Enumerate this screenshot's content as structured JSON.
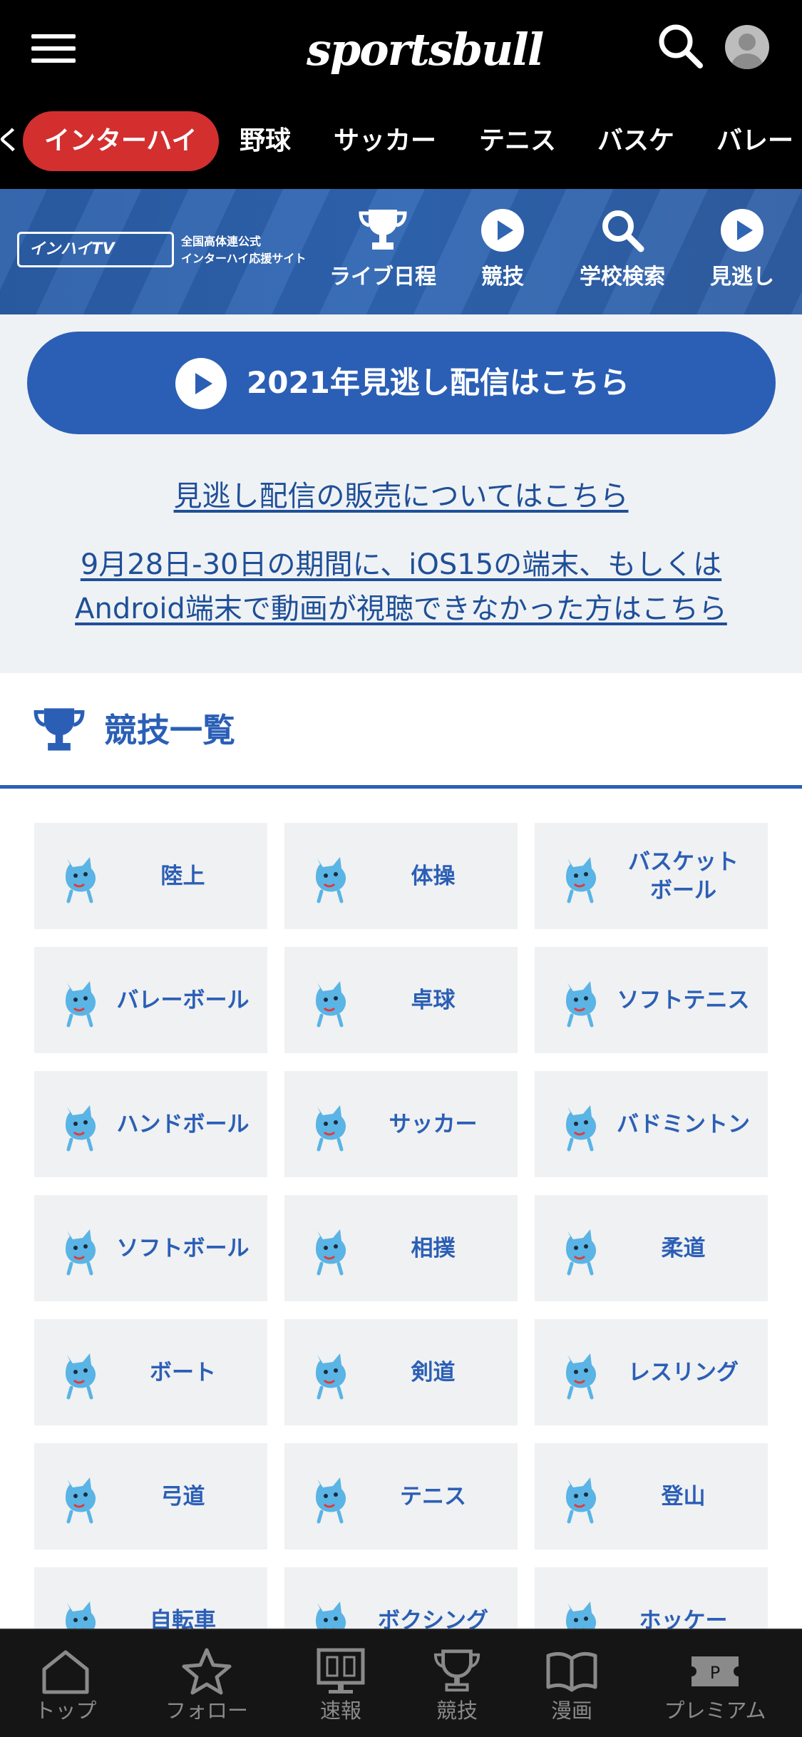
{
  "app": {
    "logo_text": "sportsbull"
  },
  "header": {
    "tabs": [
      {
        "label": "インターハイ",
        "active": true
      },
      {
        "label": "野球",
        "active": false
      },
      {
        "label": "サッカー",
        "active": false
      },
      {
        "label": "テニス",
        "active": false
      },
      {
        "label": "バスケ",
        "active": false
      },
      {
        "label": "バレー",
        "active": false
      }
    ]
  },
  "interhigh": {
    "logo_text": "インハイTV",
    "subtitle": [
      "全国高体連公式",
      "インターハイ応援サイト"
    ],
    "nav": [
      {
        "label": "ライブ日程",
        "icon": "trophy-icon"
      },
      {
        "label": "競技",
        "icon": "play-icon"
      },
      {
        "label": "学校検索",
        "icon": "search-icon"
      },
      {
        "label": "見逃し",
        "icon": "play-icon"
      }
    ]
  },
  "replay_button": {
    "label": "2021年見逃し配信はこちら"
  },
  "links": {
    "sales": "見逃し配信の販売についてはこちら",
    "ios_line1": "9月28日-30日の期間に、iOS15の端末、もしくは",
    "ios_line2": "Android端末で動画が視聴できなかった方はこちら"
  },
  "sports_section": {
    "title": "競技一覧",
    "items": [
      {
        "label": "陸上"
      },
      {
        "label": "体操"
      },
      {
        "label": "バスケット\nボール"
      },
      {
        "label": "バレーボール"
      },
      {
        "label": "卓球"
      },
      {
        "label": "ソフトテニス"
      },
      {
        "label": "ハンドボール"
      },
      {
        "label": "サッカー"
      },
      {
        "label": "バドミントン"
      },
      {
        "label": "ソフトボール"
      },
      {
        "label": "相撲"
      },
      {
        "label": "柔道"
      },
      {
        "label": "ボート"
      },
      {
        "label": "剣道"
      },
      {
        "label": "レスリング"
      },
      {
        "label": "弓道"
      },
      {
        "label": "テニス"
      },
      {
        "label": "登山"
      },
      {
        "label": "自転車"
      },
      {
        "label": "ボクシング"
      },
      {
        "label": "ホッケー"
      }
    ]
  },
  "bottom_nav": [
    {
      "label": "トップ",
      "icon": "home-icon"
    },
    {
      "label": "フォロー",
      "icon": "star-icon"
    },
    {
      "label": "速報",
      "icon": "scoreboard-icon"
    },
    {
      "label": "競技",
      "icon": "trophy-icon"
    },
    {
      "label": "漫画",
      "icon": "book-icon"
    },
    {
      "label": "プレミアム",
      "icon": "premium-ticket-icon"
    }
  ],
  "colors": {
    "accent_blue": "#2b5fb6",
    "active_red": "#d32f2f",
    "header_bg": "#000000"
  }
}
